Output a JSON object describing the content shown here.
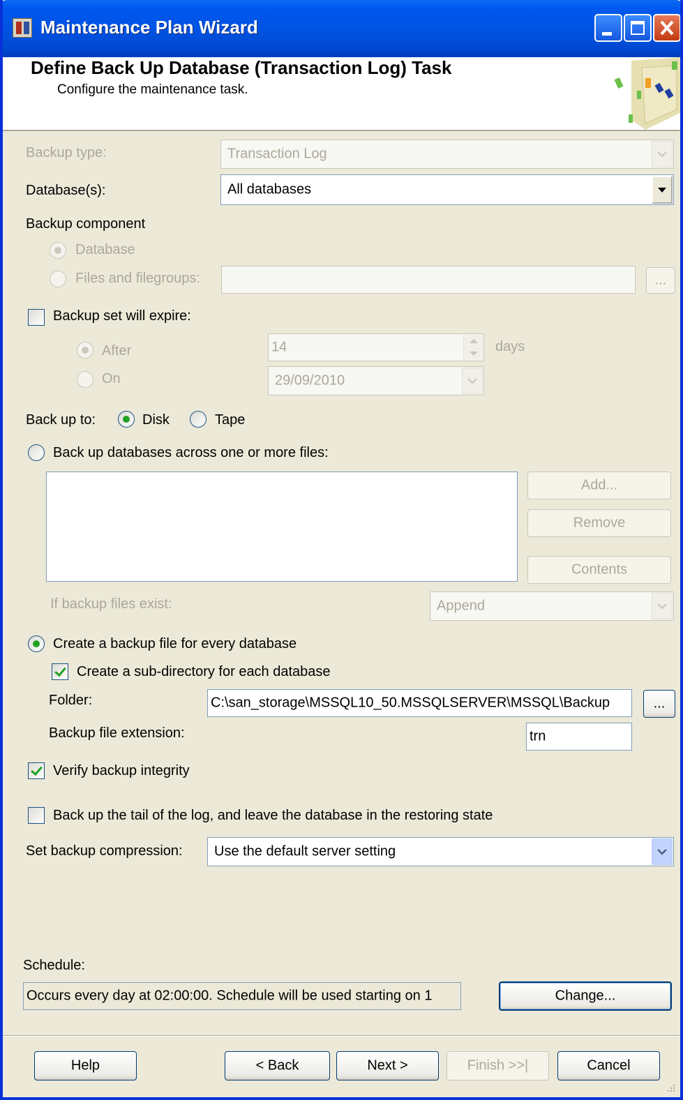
{
  "window": {
    "title": "Maintenance Plan Wizard"
  },
  "header": {
    "title": "Define Back Up Database (Transaction Log) Task",
    "subtitle": "Configure the maintenance task."
  },
  "backup_type": {
    "label": "Backup type:",
    "value": "Transaction Log"
  },
  "databases": {
    "label": "Database(s):",
    "value": "All databases"
  },
  "backup_component": {
    "label": "Backup component",
    "database_label": "Database",
    "files_label": "Files and filegroups:",
    "browse": "..."
  },
  "expire": {
    "label": "Backup set will expire:",
    "after_label": "After",
    "after_value": "14",
    "days_label": "days",
    "on_label": "On",
    "on_value": "29/09/2010"
  },
  "backup_to": {
    "label": "Back up to:",
    "disk": "Disk",
    "tape": "Tape"
  },
  "across_files": {
    "label": "Back up databases across one or more files:",
    "add": "Add...",
    "remove": "Remove",
    "contents": "Contents",
    "exist_label": "If backup files exist:",
    "exist_value": "Append"
  },
  "per_db": {
    "label": "Create a backup file for every database",
    "subdir_label": "Create a sub-directory for each database",
    "folder_label": "Folder:",
    "folder_value": "C:\\san_storage\\MSSQL10_50.MSSQLSERVER\\MSSQL\\Backup",
    "browse": "...",
    "ext_label": "Backup file extension:",
    "ext_value": "trn"
  },
  "verify": {
    "label": "Verify backup integrity"
  },
  "tail": {
    "label": "Back up the tail of the log, and leave the database in the restoring state"
  },
  "compression": {
    "label": "Set backup compression:",
    "value": "Use the default server setting"
  },
  "schedule": {
    "label": "Schedule:",
    "value": "Occurs every day at 02:00:00. Schedule will be used starting on 1",
    "change": "Change..."
  },
  "footer": {
    "help": "Help",
    "back": "< Back",
    "next": "Next >",
    "finish": "Finish >>|",
    "cancel": "Cancel"
  }
}
